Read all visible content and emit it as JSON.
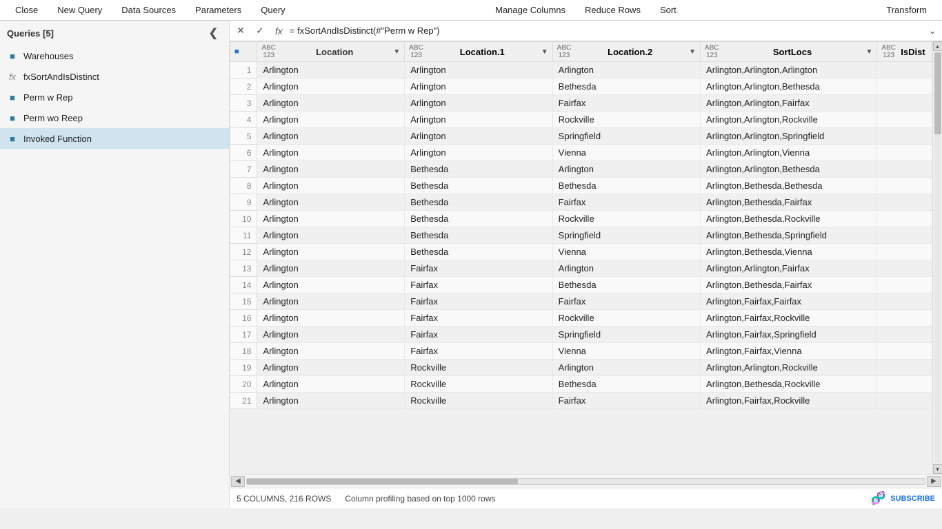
{
  "menu": {
    "close": "Close",
    "new_query": "New Query",
    "data_sources": "Data Sources",
    "parameters": "Parameters",
    "query": "Query",
    "manage_columns": "Manage Columns",
    "reduce_rows": "Reduce Rows",
    "sort": "Sort",
    "transform": "Transform"
  },
  "sidebar": {
    "title": "Queries [5]",
    "items": [
      {
        "id": "warehouses",
        "label": "Warehouses",
        "icon": "table"
      },
      {
        "id": "fxsort",
        "label": "fxSortAndIsDistinct",
        "icon": "fx"
      },
      {
        "id": "perm-w-rep",
        "label": "Perm w Rep",
        "icon": "table"
      },
      {
        "id": "perm-wo-reep",
        "label": "Perm wo Reep",
        "icon": "table"
      },
      {
        "id": "invoked-function",
        "label": "Invoked Function",
        "icon": "table",
        "active": true
      }
    ]
  },
  "formula_bar": {
    "formula": "= fxSortAndIsDistinct(#\"Perm w Rep\")"
  },
  "columns": [
    {
      "id": "location",
      "label": "Location",
      "type": "ABC\n123",
      "highlighted": true
    },
    {
      "id": "location1",
      "label": "Location.1",
      "type": "ABC\n123"
    },
    {
      "id": "location2",
      "label": "Location.2",
      "type": "ABC\n123"
    },
    {
      "id": "sortlocs",
      "label": "SortLocs",
      "type": "ABC\n123"
    },
    {
      "id": "isdist",
      "label": "IsDist",
      "type": "ABC\n123"
    }
  ],
  "rows": [
    [
      1,
      "Arlington",
      "Arlington",
      "Arlington",
      "Arlington,Arlington,Arlington",
      ""
    ],
    [
      2,
      "Arlington",
      "Arlington",
      "Bethesda",
      "Arlington,Arlington,Bethesda",
      ""
    ],
    [
      3,
      "Arlington",
      "Arlington",
      "Fairfax",
      "Arlington,Arlington,Fairfax",
      ""
    ],
    [
      4,
      "Arlington",
      "Arlington",
      "Rockville",
      "Arlington,Arlington,Rockville",
      ""
    ],
    [
      5,
      "Arlington",
      "Arlington",
      "Springfield",
      "Arlington,Arlington,Springfield",
      ""
    ],
    [
      6,
      "Arlington",
      "Arlington",
      "Vienna",
      "Arlington,Arlington,Vienna",
      ""
    ],
    [
      7,
      "Arlington",
      "Bethesda",
      "Arlington",
      "Arlington,Arlington,Bethesda",
      ""
    ],
    [
      8,
      "Arlington",
      "Bethesda",
      "Bethesda",
      "Arlington,Bethesda,Bethesda",
      ""
    ],
    [
      9,
      "Arlington",
      "Bethesda",
      "Fairfax",
      "Arlington,Bethesda,Fairfax",
      ""
    ],
    [
      10,
      "Arlington",
      "Bethesda",
      "Rockville",
      "Arlington,Bethesda,Rockville",
      ""
    ],
    [
      11,
      "Arlington",
      "Bethesda",
      "Springfield",
      "Arlington,Bethesda,Springfield",
      ""
    ],
    [
      12,
      "Arlington",
      "Bethesda",
      "Vienna",
      "Arlington,Bethesda,Vienna",
      ""
    ],
    [
      13,
      "Arlington",
      "Fairfax",
      "Arlington",
      "Arlington,Arlington,Fairfax",
      ""
    ],
    [
      14,
      "Arlington",
      "Fairfax",
      "Bethesda",
      "Arlington,Bethesda,Fairfax",
      ""
    ],
    [
      15,
      "Arlington",
      "Fairfax",
      "Fairfax",
      "Arlington,Fairfax,Fairfax",
      ""
    ],
    [
      16,
      "Arlington",
      "Fairfax",
      "Rockville",
      "Arlington,Fairfax,Rockville",
      ""
    ],
    [
      17,
      "Arlington",
      "Fairfax",
      "Springfield",
      "Arlington,Fairfax,Springfield",
      ""
    ],
    [
      18,
      "Arlington",
      "Fairfax",
      "Vienna",
      "Arlington,Fairfax,Vienna",
      ""
    ],
    [
      19,
      "Arlington",
      "Rockville",
      "Arlington",
      "Arlington,Arlington,Rockville",
      ""
    ],
    [
      20,
      "Arlington",
      "Rockville",
      "Bethesda",
      "Arlington,Bethesda,Rockville",
      ""
    ],
    [
      21,
      "Arlington",
      "Rockville",
      "Fairfax",
      "Arlington,Fairfax,Rockville",
      ""
    ]
  ],
  "status_bar": {
    "columns": "5 COLUMNS, 216 ROWS",
    "profiling": "Column profiling based on top 1000 rows"
  }
}
